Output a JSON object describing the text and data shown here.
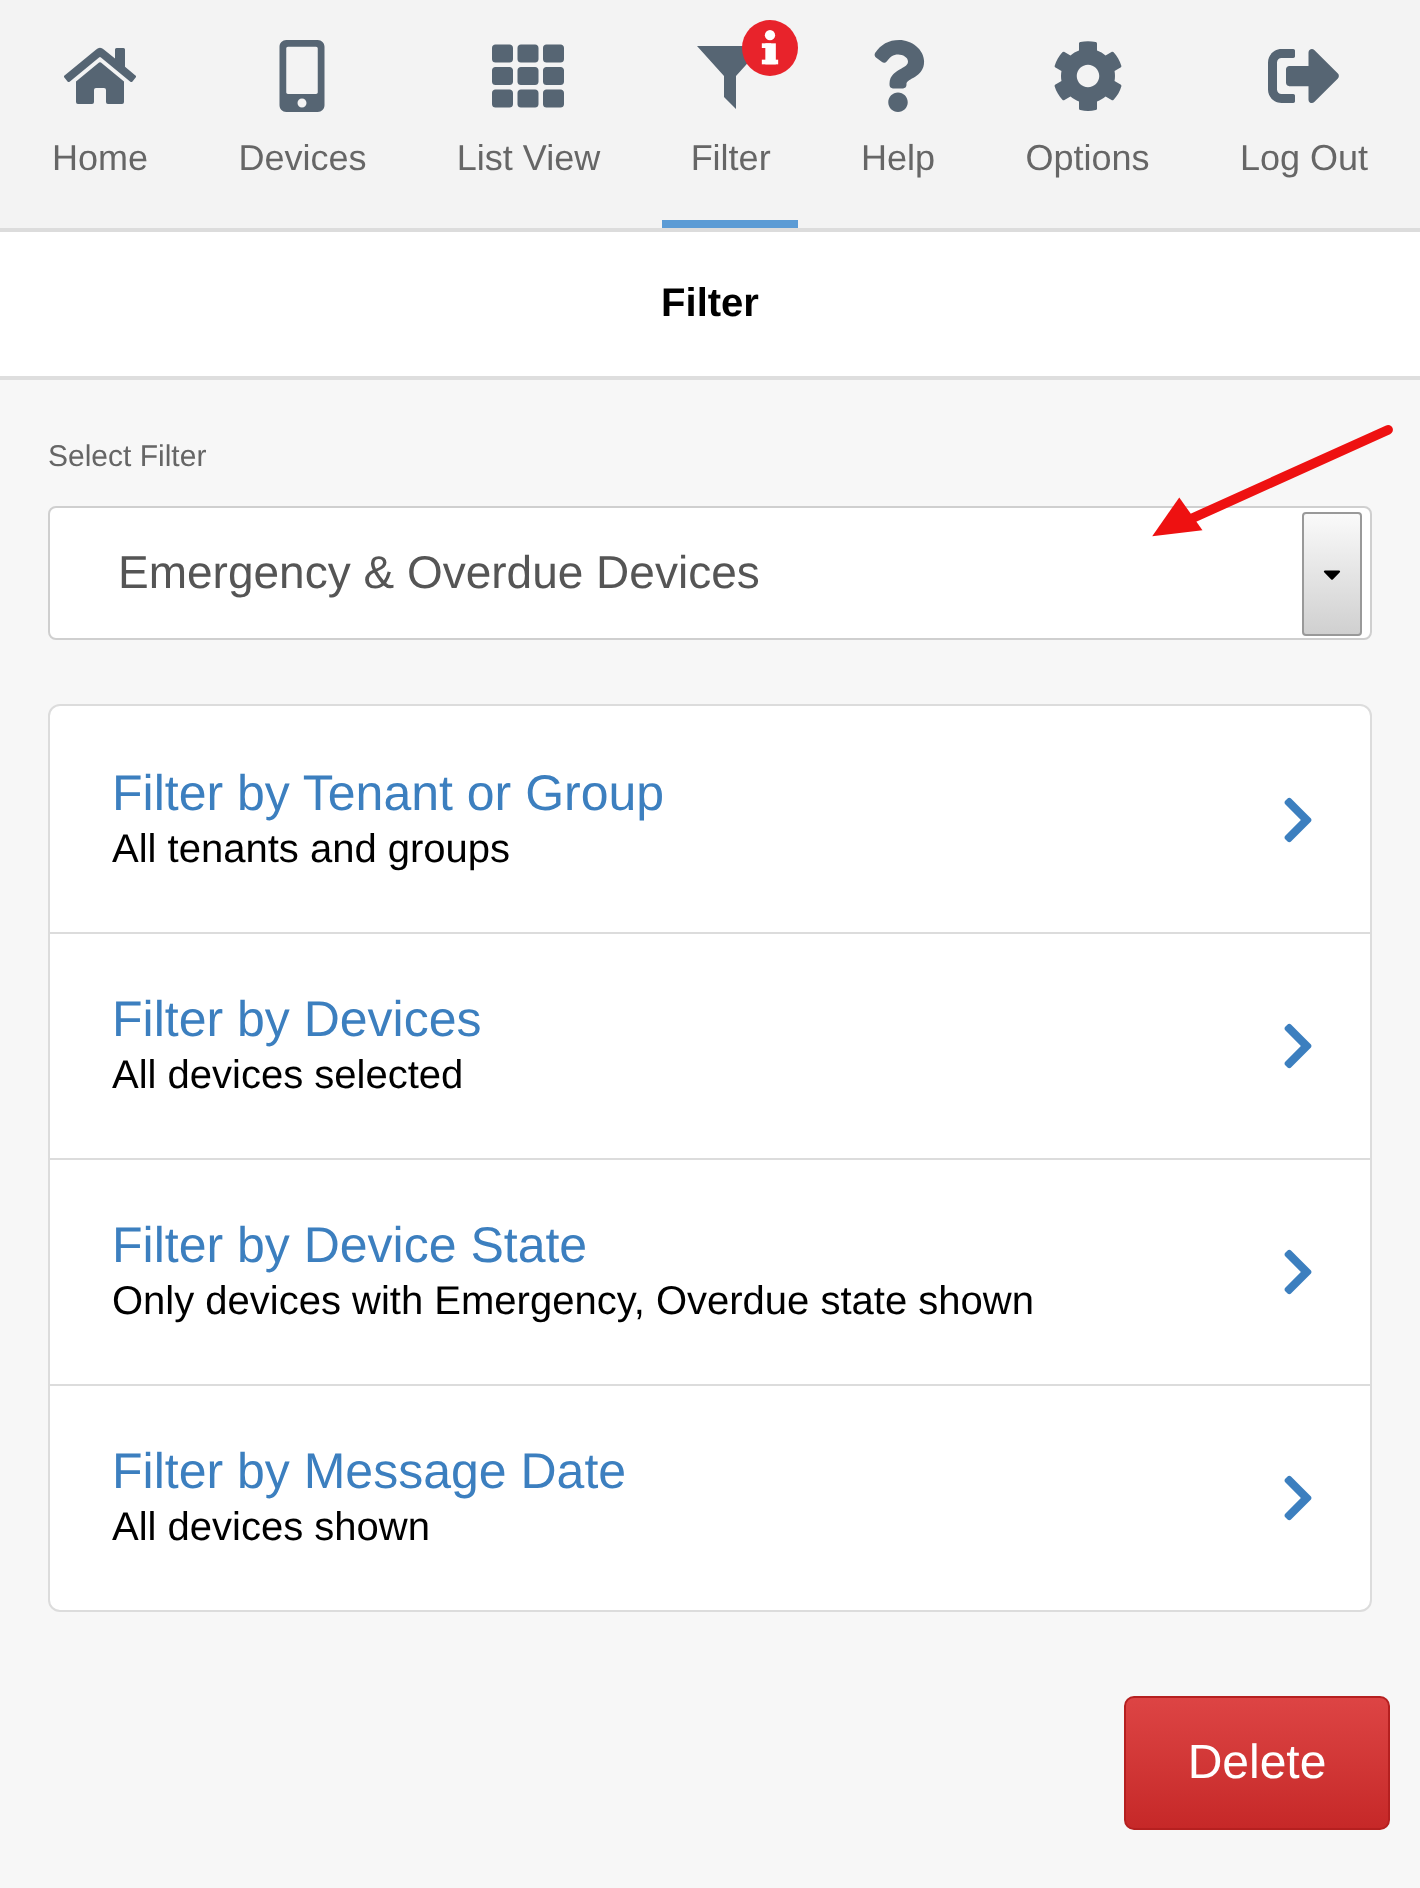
{
  "nav": [
    {
      "label": "Home",
      "selected": false,
      "alert": false
    },
    {
      "label": "Devices",
      "selected": false,
      "alert": false
    },
    {
      "label": "List View",
      "selected": false,
      "alert": false
    },
    {
      "label": "Filter",
      "selected": true,
      "alert": true
    },
    {
      "label": "Help",
      "selected": false,
      "alert": false
    },
    {
      "label": "Options",
      "selected": false,
      "alert": false
    },
    {
      "label": "Log Out",
      "selected": false,
      "alert": false
    }
  ],
  "page_title": "Filter",
  "select": {
    "label": "Select Filter",
    "value": "Emergency & Overdue Devices"
  },
  "filters": [
    {
      "title": "Filter by Tenant or Group",
      "summary": "All tenants and groups"
    },
    {
      "title": "Filter by Devices",
      "summary": "All devices selected"
    },
    {
      "title": "Filter by Device State",
      "summary": "Only devices with Emergency, Overdue state shown"
    },
    {
      "title": "Filter by Message Date",
      "summary": "All devices shown"
    }
  ],
  "delete_button": "Delete"
}
